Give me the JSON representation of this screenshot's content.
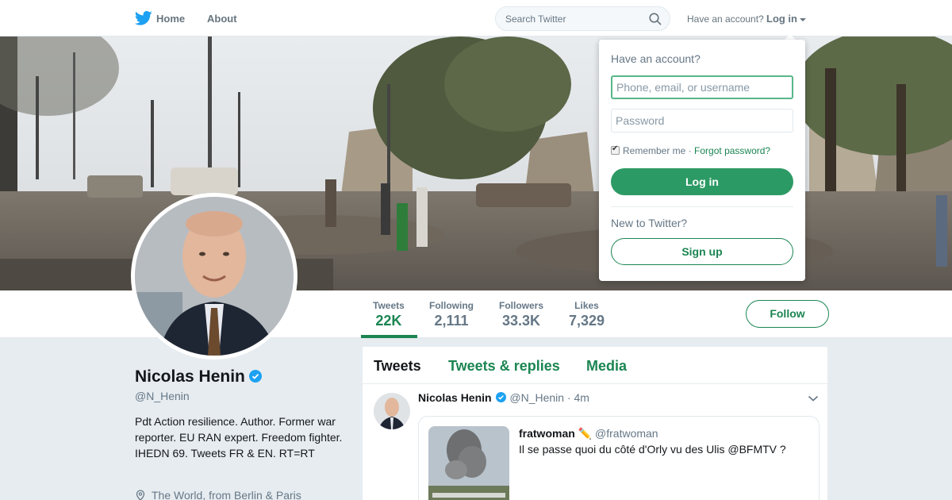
{
  "nav": {
    "home": "Home",
    "about": "About",
    "search_placeholder": "Search Twitter",
    "have_account": "Have an account?",
    "login": "Log in"
  },
  "profile": {
    "name": "Nicolas Henin",
    "handle": "@N_Henin",
    "bio": "Pdt Action resilience. Author. Former war reporter. EU RAN expert. Freedom fighter. IHEDN 69. Tweets FR & EN. RT=RT",
    "location": "The World, from Berlin & Paris"
  },
  "stats": [
    {
      "label": "Tweets",
      "value": "22K"
    },
    {
      "label": "Following",
      "value": "2,111"
    },
    {
      "label": "Followers",
      "value": "33.3K"
    },
    {
      "label": "Likes",
      "value": "7,329"
    }
  ],
  "follow_label": "Follow",
  "timeline": {
    "tabs": [
      "Tweets",
      "Tweets & replies",
      "Media"
    ],
    "tweet": {
      "author": "Nicolas Henin",
      "handle": "@N_Henin",
      "time": "4m",
      "quote": {
        "author": "fratwoman",
        "emoji": "✏️",
        "handle": "@fratwoman",
        "text": "Il se passe quoi du côté d'Orly vu des Ulis @BFMTV ?"
      }
    }
  },
  "login_dropdown": {
    "title": "Have an account?",
    "username_placeholder": "Phone, email, or username",
    "password_placeholder": "Password",
    "remember": "Remember me",
    "separator": "·",
    "forgot": "Forgot password?",
    "login_button": "Log in",
    "new_to": "New to Twitter?",
    "signup_button": "Sign up"
  },
  "colors": {
    "accent": "#1b8552",
    "login_button": "#2c9a64",
    "verified": "#1da1f2",
    "twitter_blue": "#1da1f2"
  }
}
